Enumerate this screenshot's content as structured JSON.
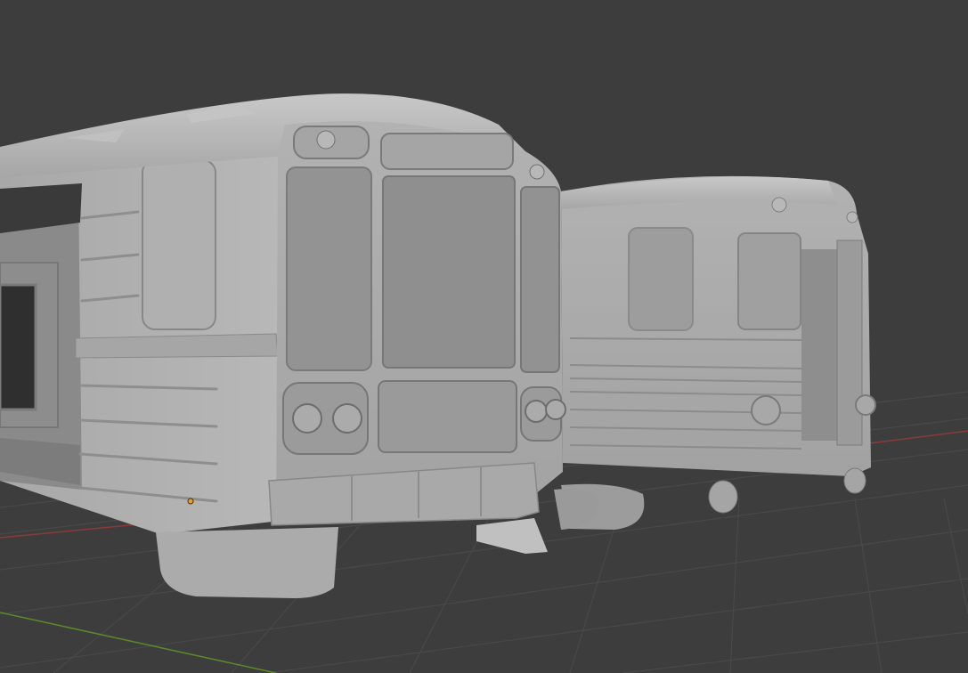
{
  "viewport": {
    "colors": {
      "background": "#3d3d3d",
      "grid_line": "#4a4a4a",
      "x_axis": "#8a3a3a",
      "y_axis": "#5a8a2a",
      "model_light": "#b4b4b4",
      "model_mid": "#9a9a9a",
      "model_dark": "#6e6e6e",
      "origin_marker": "#e8a030"
    },
    "objects": [
      "near-train-car",
      "far-train-car"
    ]
  }
}
